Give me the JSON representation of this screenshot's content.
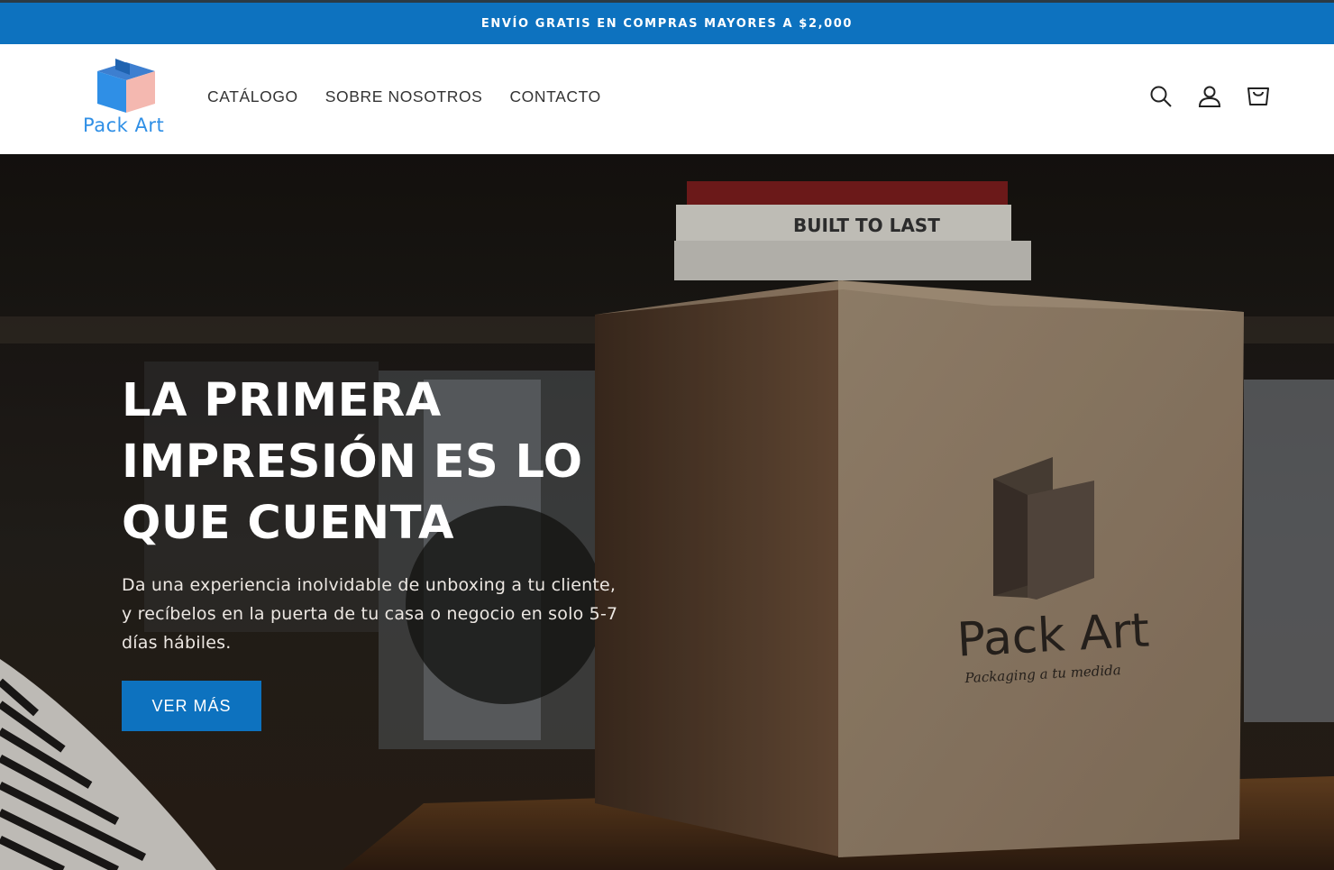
{
  "announcement": {
    "text": "ENVÍO GRATIS EN COMPRAS MAYORES A $2,000"
  },
  "header": {
    "logo_text": "Pack Art",
    "nav": [
      {
        "label": "CATÁLOGO"
      },
      {
        "label": "SOBRE NOSOTROS"
      },
      {
        "label": "CONTACTO"
      }
    ],
    "icons": [
      "search-icon",
      "account-icon",
      "cart-icon"
    ]
  },
  "hero": {
    "title_lines": [
      "LA PRIMERA",
      "IMPRESIÓN ES LO",
      "QUE CUENTA"
    ],
    "subtitle": "Da una experiencia inolvidable de unboxing a tu cliente, y recíbelos en la puerta de tu casa o negocio en solo 5-7 días hábiles.",
    "button_label": "VER MÁS",
    "box_brand": "Pack Art",
    "box_tagline": "Packaging a tu medida",
    "book_spine": "BUILT TO LAST"
  },
  "colors": {
    "brand_blue": "#0d72bf",
    "logo_blue": "#2f8fe6",
    "logo_pink": "#f4b8b0"
  }
}
